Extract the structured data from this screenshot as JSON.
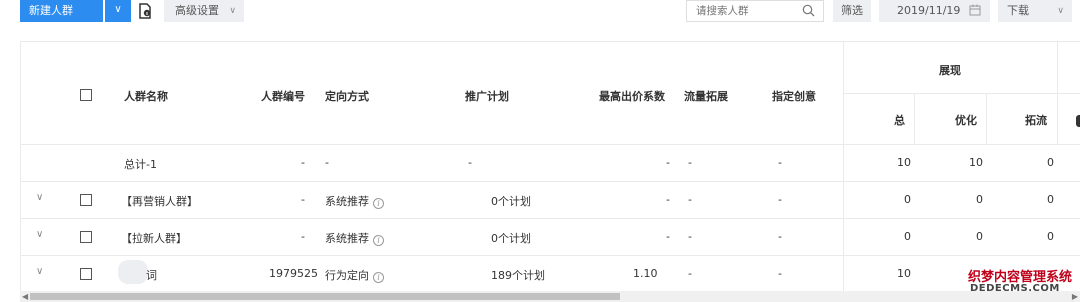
{
  "toolbar": {
    "new_group_label": "新建人群",
    "advanced_settings_label": "高级设置",
    "search_placeholder": "请搜索人群",
    "filter_label": "筛选",
    "date_value": "2019/11/19",
    "download_label": "下载"
  },
  "table": {
    "headers": {
      "name": "人群名称",
      "id": "人群编号",
      "targeting": "定向方式",
      "plan": "推广计划",
      "max_bid": "最高出价系数",
      "traffic_expand": "流量拓展",
      "creative": "指定创意",
      "impression_group": "展现",
      "impression_total": "总",
      "impression_optimize": "优化",
      "impression_expand": "拓流"
    },
    "total_row": {
      "name": "总计-1",
      "id": "-",
      "targeting": "-",
      "plan": "-",
      "max_bid": "-",
      "traffic_expand": "-",
      "creative": "-",
      "total": "10",
      "optimize": "10",
      "expand": "0"
    },
    "rows": [
      {
        "name": "【再营销人群】",
        "id": "-",
        "targeting": "系统推荐",
        "plan": "0个计划",
        "max_bid": "-",
        "traffic_expand": "-",
        "creative": "-",
        "total": "0",
        "optimize": "0",
        "expand": "0"
      },
      {
        "name": "【拉新人群】",
        "id": "-",
        "targeting": "系统推荐",
        "plan": "0个计划",
        "max_bid": "-",
        "traffic_expand": "-",
        "creative": "-",
        "total": "0",
        "optimize": "0",
        "expand": "0"
      },
      {
        "name": "词",
        "id": "1979525",
        "targeting": "行为定向",
        "plan": "189个计划",
        "max_bid": "1.10",
        "traffic_expand": "-",
        "creative": "-",
        "total": "10"
      }
    ]
  },
  "watermark": {
    "line1": "织梦内容管理系统",
    "line2": "DEDECMS.COM"
  },
  "colors": {
    "primary": "#2d8cf0",
    "border": "#e8eaec",
    "button_bg": "#eeeff2"
  }
}
